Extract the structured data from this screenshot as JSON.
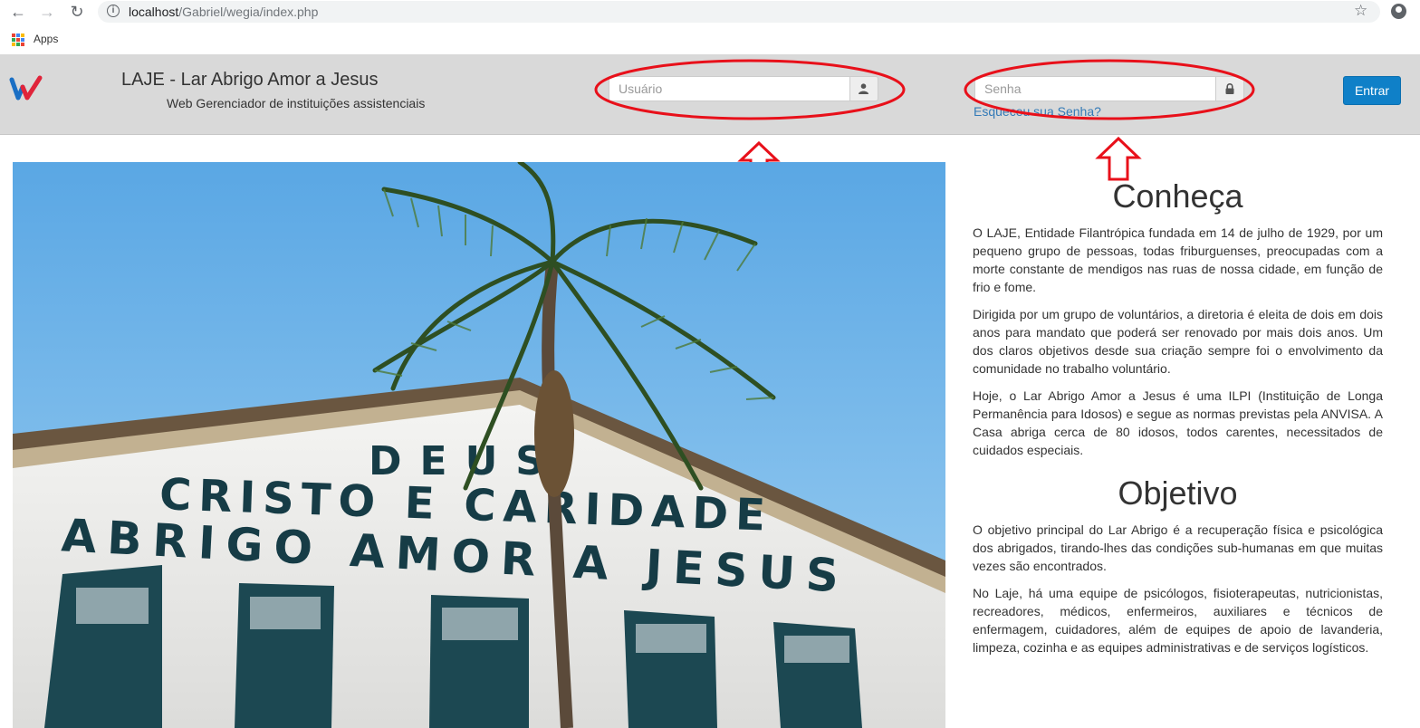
{
  "browser": {
    "url_host": "localhost",
    "url_path": "/Gabriel/wegia/index.php",
    "bookmarks": {
      "apps_label": "Apps"
    }
  },
  "header": {
    "title": "LAJE - Lar Abrigo Amor a Jesus",
    "subtitle": "Web Gerenciador de instituições assistenciais",
    "username_placeholder": "Usuário",
    "password_placeholder": "Senha",
    "forgot_password": "Esqueceu sua Senha?",
    "login_button": "Entrar"
  },
  "photo": {
    "sign_line1": "DEUS",
    "sign_line2": "CRISTO E CARIDADE",
    "sign_line3": "ABRIGO AMOR A JESUS"
  },
  "about": {
    "heading": "Conheça",
    "paragraphs": [
      "O LAJE, Entidade Filantrópica fundada em 14 de julho de 1929, por um pequeno grupo de pessoas, todas friburguenses, preocupadas com a morte constante de mendigos nas ruas de nossa cidade, em função de frio e fome.",
      "Dirigida por um grupo de voluntários, a diretoria é eleita de dois em dois anos para mandato que poderá ser renovado por mais dois anos. Um dos claros objetivos desde sua criação sempre foi o envolvimento da comunidade no trabalho voluntário.",
      "Hoje, o Lar Abrigo Amor a Jesus é uma ILPI (Instituição de Longa Permanência para Idosos) e segue as normas previstas pela ANVISA. A Casa abriga cerca de 80 idosos, todos carentes, necessitados de cuidados especiais."
    ]
  },
  "objective": {
    "heading": "Objetivo",
    "paragraphs": [
      "O objetivo principal do Lar Abrigo é a recuperação física e psicológica dos abrigados, tirando-lhes das condições sub-humanas em que muitas vezes são encontrados.",
      "No Laje, há uma equipe de psicólogos, fisioterapeutas, nutricionistas, recreadores, médicos, enfermeiros, auxiliares e técnicos de enfermagem, cuidadores, além de equipes de apoio de lavanderia, limpeza, cozinha e as equipes administrativas e de serviços logísticos."
    ]
  },
  "colors": {
    "header_bg": "#d9d9d9",
    "primary_button": "#0f80c8",
    "link": "#337ab7",
    "annotation_red": "#e8101a",
    "sky": "#7fbce8",
    "sign_letters": "#163c46"
  },
  "icons": [
    "back-arrow-icon",
    "forward-arrow-icon",
    "reload-icon",
    "info-icon",
    "star-icon",
    "profile-icon",
    "apps-grid-icon",
    "user-icon",
    "lock-icon",
    "wegia-logo"
  ]
}
